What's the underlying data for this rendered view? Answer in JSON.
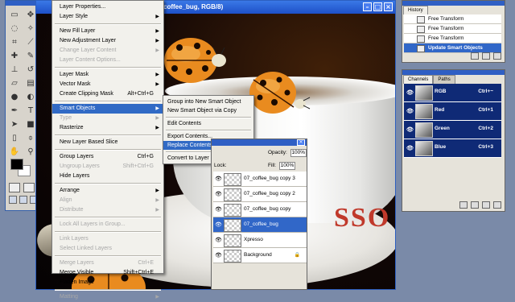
{
  "document": {
    "title": "coffee_bug, RGB/8)",
    "cup_text": "SSO"
  },
  "layer_menu": {
    "items": [
      {
        "label": "Layer Properties...",
        "shortcut": "",
        "submenu": false,
        "disabled": false
      },
      {
        "label": "Layer Style",
        "shortcut": "",
        "submenu": true,
        "disabled": false
      },
      {
        "sep": true
      },
      {
        "label": "New Fill Layer",
        "shortcut": "",
        "submenu": true,
        "disabled": false
      },
      {
        "label": "New Adjustment Layer",
        "shortcut": "",
        "submenu": true,
        "disabled": false
      },
      {
        "label": "Change Layer Content",
        "shortcut": "",
        "submenu": true,
        "disabled": true
      },
      {
        "label": "Layer Content Options...",
        "shortcut": "",
        "submenu": false,
        "disabled": true
      },
      {
        "sep": true
      },
      {
        "label": "Layer Mask",
        "shortcut": "",
        "submenu": true,
        "disabled": false
      },
      {
        "label": "Vector Mask",
        "shortcut": "",
        "submenu": true,
        "disabled": false
      },
      {
        "label": "Create Clipping Mask",
        "shortcut": "Alt+Ctrl+G",
        "submenu": false,
        "disabled": false
      },
      {
        "sep": true
      },
      {
        "label": "Smart Objects",
        "shortcut": "",
        "submenu": true,
        "disabled": false,
        "selected": true
      },
      {
        "label": "Type",
        "shortcut": "",
        "submenu": true,
        "disabled": true
      },
      {
        "label": "Rasterize",
        "shortcut": "",
        "submenu": true,
        "disabled": false
      },
      {
        "sep": true
      },
      {
        "label": "New Layer Based Slice",
        "shortcut": "",
        "submenu": false,
        "disabled": false
      },
      {
        "sep": true
      },
      {
        "label": "Group Layers",
        "shortcut": "Ctrl+G",
        "submenu": false,
        "disabled": false
      },
      {
        "label": "Ungroup Layers",
        "shortcut": "Shift+Ctrl+G",
        "submenu": false,
        "disabled": true
      },
      {
        "label": "Hide Layers",
        "shortcut": "",
        "submenu": false,
        "disabled": false
      },
      {
        "sep": true
      },
      {
        "label": "Arrange",
        "shortcut": "",
        "submenu": true,
        "disabled": false
      },
      {
        "label": "Align",
        "shortcut": "",
        "submenu": true,
        "disabled": true
      },
      {
        "label": "Distribute",
        "shortcut": "",
        "submenu": true,
        "disabled": true
      },
      {
        "sep": true
      },
      {
        "label": "Lock All Layers in Group...",
        "shortcut": "",
        "submenu": false,
        "disabled": true
      },
      {
        "sep": true
      },
      {
        "label": "Link Layers",
        "shortcut": "",
        "submenu": false,
        "disabled": true
      },
      {
        "label": "Select Linked Layers",
        "shortcut": "",
        "submenu": false,
        "disabled": true
      },
      {
        "sep": true
      },
      {
        "label": "Merge Layers",
        "shortcut": "Ctrl+E",
        "submenu": false,
        "disabled": true
      },
      {
        "label": "Merge Visible",
        "shortcut": "Shift+Ctrl+E",
        "submenu": false,
        "disabled": false
      },
      {
        "label": "Flatten Image",
        "shortcut": "",
        "submenu": false,
        "disabled": false
      },
      {
        "sep": true
      },
      {
        "label": "Matting",
        "shortcut": "",
        "submenu": true,
        "disabled": true
      }
    ]
  },
  "smart_objects_menu": {
    "items": [
      {
        "label": "Group into New Smart Object",
        "selected": false
      },
      {
        "label": "New Smart Object via Copy",
        "selected": false
      },
      {
        "sep": true
      },
      {
        "label": "Edit Contents",
        "selected": false
      },
      {
        "sep": true
      },
      {
        "label": "Export Contents...",
        "selected": false
      },
      {
        "label": "Replace Contents...",
        "selected": true
      },
      {
        "sep": true
      },
      {
        "label": "Convert to Layer",
        "selected": false
      }
    ]
  },
  "history": {
    "tab": "History",
    "items": [
      {
        "label": "Free Transform",
        "selected": false
      },
      {
        "label": "Free Transform",
        "selected": false
      },
      {
        "label": "Free Transform",
        "selected": false
      },
      {
        "label": "Update Smart Objects",
        "selected": true
      }
    ]
  },
  "channels": {
    "tabs": [
      "Channels",
      "Paths"
    ],
    "rows": [
      {
        "name": "RGB",
        "shortcut": "Ctrl+~"
      },
      {
        "name": "Red",
        "shortcut": "Ctrl+1"
      },
      {
        "name": "Green",
        "shortcut": "Ctrl+2"
      },
      {
        "name": "Blue",
        "shortcut": "Ctrl+3"
      }
    ]
  },
  "layers_panel": {
    "opacity_label": "Opacity:",
    "opacity_value": "100%",
    "fill_label": "Fill:",
    "fill_value": "100%",
    "lock_label": "Lock:",
    "layers": [
      {
        "name": "07_coffee_bug copy 3",
        "selected": false,
        "locked": false
      },
      {
        "name": "07_coffee_bug copy 2",
        "selected": false,
        "locked": false
      },
      {
        "name": "07_coffee_bug copy",
        "selected": false,
        "locked": false
      },
      {
        "name": "07_coffee_bug",
        "selected": true,
        "locked": false
      },
      {
        "name": "Xpresso",
        "selected": false,
        "locked": false
      },
      {
        "name": "Background",
        "selected": false,
        "locked": true
      }
    ]
  },
  "icons": {
    "eye": "👁",
    "arrow": "▶",
    "lock": "🔒"
  }
}
